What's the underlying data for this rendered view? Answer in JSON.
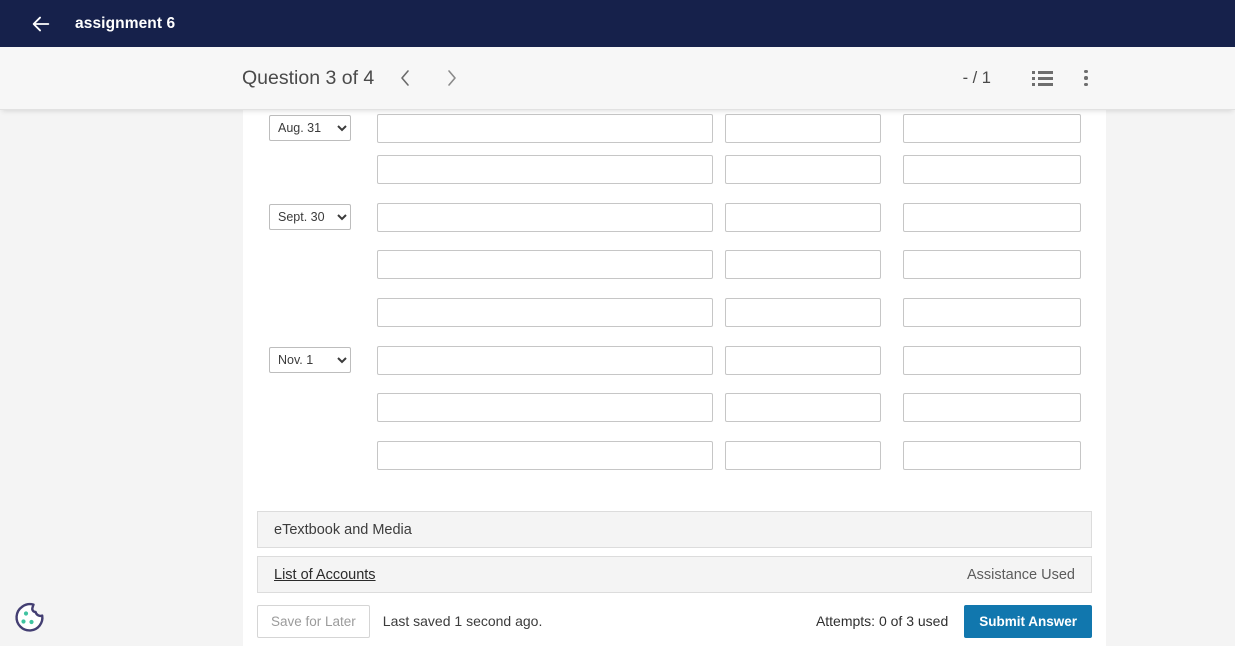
{
  "appbar": {
    "back_icon": "back-arrow-icon",
    "title": "assignment 6"
  },
  "toolbar": {
    "question_label": "Question 3 of 4",
    "prev_icon": "chevron-left-icon",
    "next_icon": "chevron-right-icon",
    "score": "- / 1",
    "list_icon": "numbered-list-icon",
    "more_icon": "more-vertical-icon"
  },
  "journal": {
    "date_options": [
      "Aug. 31",
      "Sept. 30",
      "Nov. 1"
    ],
    "rows": [
      {
        "date": "Aug. 31",
        "account": "",
        "debit": "",
        "credit": ""
      },
      {
        "date": "",
        "account": "",
        "debit": "",
        "credit": ""
      },
      {
        "date": "Sept. 30",
        "account": "",
        "debit": "",
        "credit": ""
      },
      {
        "date": "",
        "account": "",
        "debit": "",
        "credit": ""
      },
      {
        "date": "",
        "account": "",
        "debit": "",
        "credit": ""
      },
      {
        "date": "Nov. 1",
        "account": "",
        "debit": "",
        "credit": ""
      },
      {
        "date": "",
        "account": "",
        "debit": "",
        "credit": ""
      },
      {
        "date": "",
        "account": "",
        "debit": "",
        "credit": ""
      }
    ]
  },
  "panels": {
    "etextbook_label": "eTextbook and Media",
    "accounts_link": "List of Accounts",
    "assistance_label": "Assistance Used"
  },
  "actions": {
    "save_label": "Save for Later",
    "saved_status": "Last saved 1 second ago.",
    "attempts": "Attempts: 0 of 3 used",
    "submit_label": "Submit Answer"
  },
  "cookie": {
    "icon": "cookie-consent-icon",
    "outline_color": "#433e72",
    "dot_color": "#3fc3a0"
  },
  "colors": {
    "appbar_bg": "#16214b",
    "toolbar_bg": "#f7f7f7",
    "page_bg": "#f4f4f4",
    "card_bg": "#ffffff",
    "submit_blue": "#1177ae",
    "panel_bg": "#f4f4f4"
  }
}
